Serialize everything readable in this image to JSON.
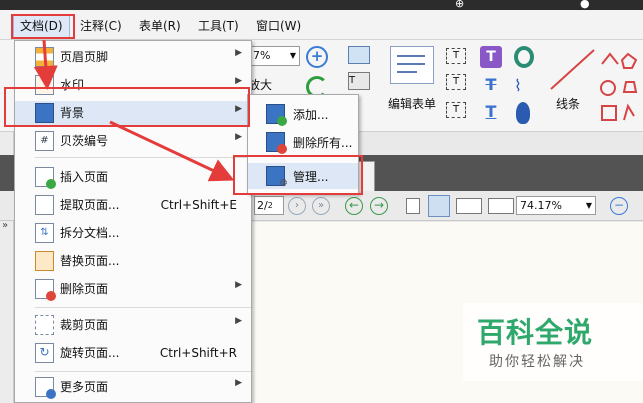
{
  "menubar": {
    "items": [
      "文档(D)",
      "注释(C)",
      "表单(R)",
      "工具(T)",
      "窗口(W)"
    ]
  },
  "ribbon": {
    "zoom_value": "7%",
    "zoom_in_label": "放大",
    "edit_form_label": "编辑表单",
    "line_label": "线条"
  },
  "document_menu": {
    "items": [
      {
        "label": "页眉页脚",
        "shortcut": "",
        "submenu": true
      },
      {
        "label": "水印",
        "shortcut": "",
        "submenu": true
      },
      {
        "label": "背景",
        "shortcut": "",
        "submenu": true
      },
      {
        "label": "贝茨编号",
        "shortcut": "",
        "submenu": true
      },
      {
        "label": "插入页面",
        "shortcut": "",
        "submenu": false
      },
      {
        "label": "提取页面...",
        "shortcut": "Ctrl+Shift+E",
        "submenu": false
      },
      {
        "label": "拆分文档...",
        "shortcut": "",
        "submenu": false
      },
      {
        "label": "替换页面...",
        "shortcut": "",
        "submenu": false
      },
      {
        "label": "删除页面",
        "shortcut": "",
        "submenu": true
      },
      {
        "label": "裁剪页面",
        "shortcut": "",
        "submenu": true
      },
      {
        "label": "旋转页面...",
        "shortcut": "Ctrl+Shift+R",
        "submenu": false
      },
      {
        "label": "更多页面",
        "shortcut": "",
        "submenu": true
      }
    ]
  },
  "background_submenu": {
    "items": [
      "添加...",
      "删除所有...",
      "管理..."
    ]
  },
  "navbar": {
    "page_value": "2",
    "page_total": "2",
    "zoom_value": "74.17%"
  },
  "watermark": {
    "title": "百科全说",
    "subtitle": "助你轻松解决"
  },
  "colors": {
    "annotation_red": "#e43b3b",
    "highlight_blue": "#dfe8f6",
    "watermark_green": "#2fa86b"
  }
}
